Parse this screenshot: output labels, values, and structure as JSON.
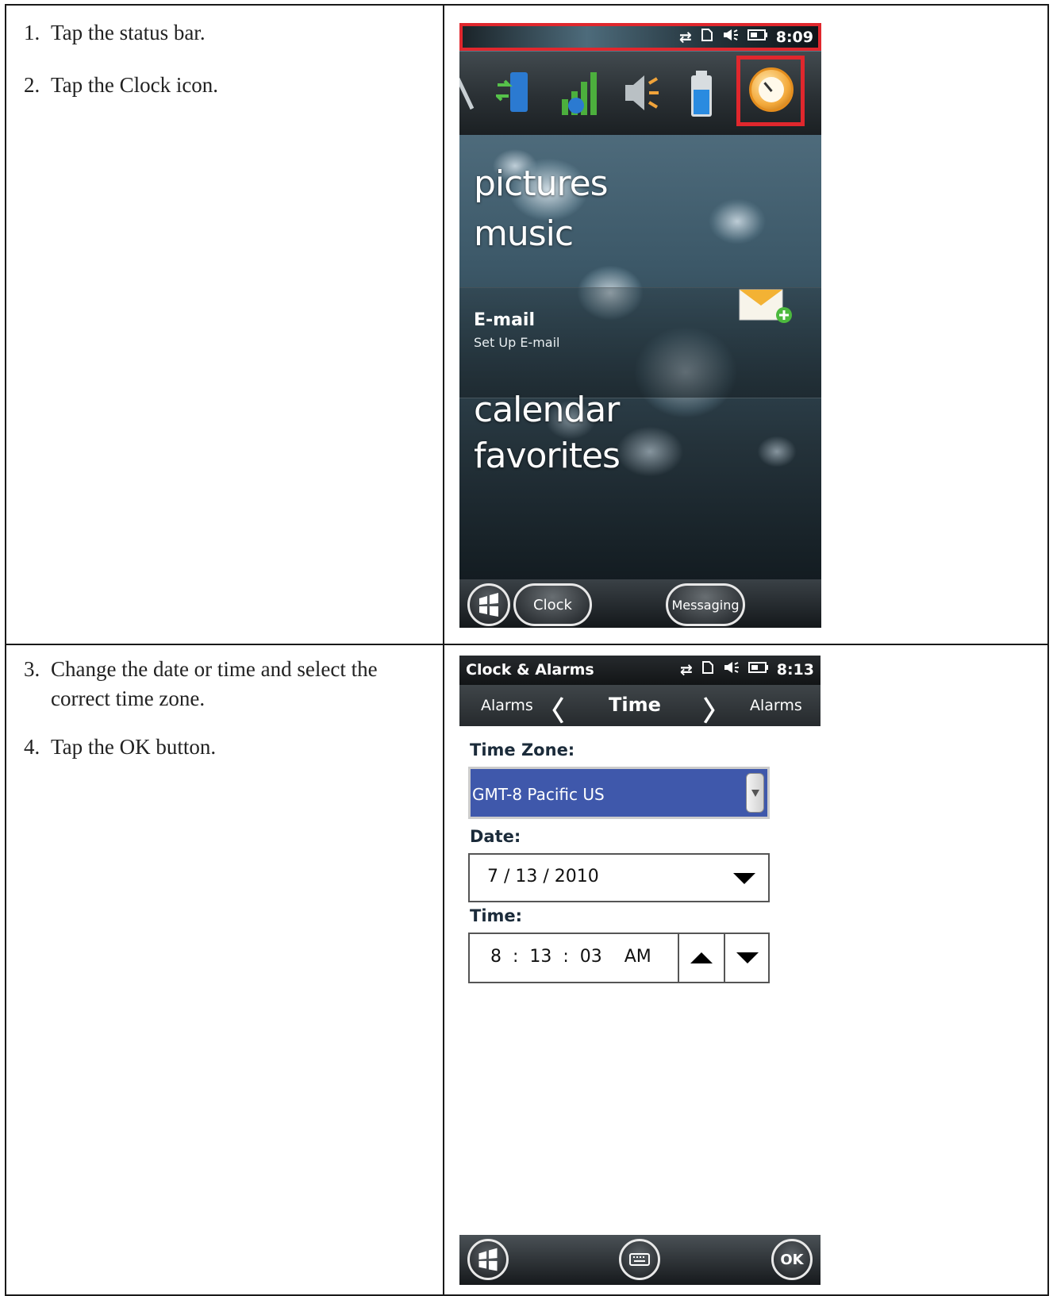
{
  "instructions": {
    "section1": [
      {
        "num": "1.",
        "text": "Tap the status bar."
      },
      {
        "num": "2.",
        "text": "Tap the Clock icon."
      }
    ],
    "section2": [
      {
        "num": "3.",
        "text": "Change the date or time and select the correct time zone."
      },
      {
        "num": "4.",
        "text": "Tap the OK button."
      }
    ]
  },
  "screen1": {
    "status_time": "8:09",
    "status_icons": [
      "connectivity-icon",
      "card-icon",
      "speaker-icon",
      "battery-icon"
    ],
    "tray_icons": [
      "search-icon",
      "connection-icon",
      "signal-icon",
      "volume-icon",
      "battery-icon",
      "clock-icon"
    ],
    "words": [
      "pictures",
      "music",
      "calendar",
      "favorites"
    ],
    "email_title": "E-mail",
    "email_subtitle": "Set Up E-mail",
    "softkey_left": "Clock",
    "softkey_right": "Messaging",
    "highlight_color": "#e0272d"
  },
  "screen2": {
    "title": "Clock & Alarms",
    "status_time": "8:13",
    "nav_left": "Alarms",
    "nav_center": "Time",
    "nav_right": "Alarms",
    "time_zone_label": "Time Zone:",
    "time_zone_value": "GMT-8 Pacific US",
    "date_label": "Date:",
    "date_value": "7  /  13  / 2010",
    "time_label": "Time:",
    "time_value": "8  :  13  :  03    AM",
    "ok_label": "OK",
    "selection_color": "#3f58ab"
  }
}
